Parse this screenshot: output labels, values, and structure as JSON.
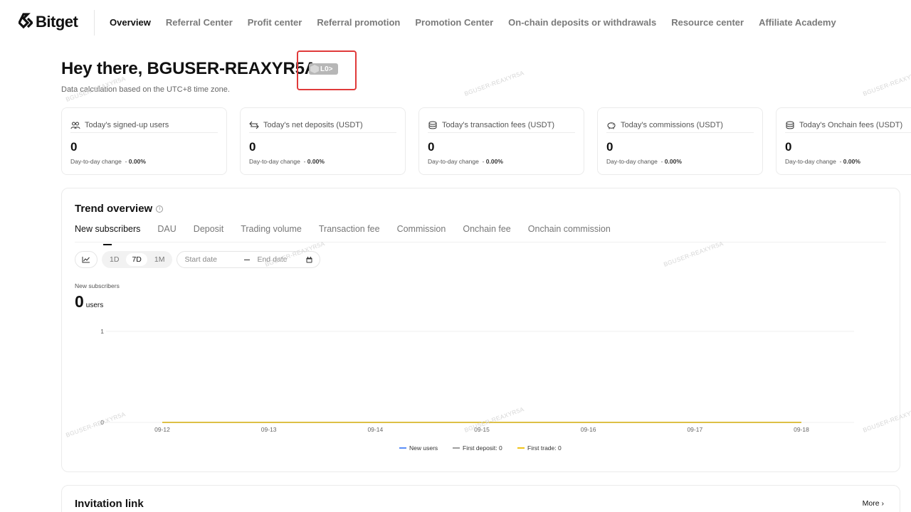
{
  "brand": {
    "name": "Bitget"
  },
  "nav": {
    "items": [
      "Overview",
      "Referral Center",
      "Profit center",
      "Referral promotion",
      "Promotion Center",
      "On-chain deposits or withdrawals",
      "Resource center",
      "Affiliate Academy"
    ],
    "active_index": 0
  },
  "greeting": {
    "text": "Hey there, BGUSER-REAXYR5A",
    "level": "L0>",
    "tz_note": "Data calculation based on the UTC+8 time zone."
  },
  "stats": [
    {
      "label": "Today's signed-up users",
      "icon": "users-icon",
      "value": "0",
      "change_label": "Day-to-day change",
      "change_value": "0.00%"
    },
    {
      "label": "Today's net deposits (USDT)",
      "icon": "transfer-arrows-icon",
      "value": "0",
      "change_label": "Day-to-day change",
      "change_value": "0.00%"
    },
    {
      "label": "Today's transaction fees (USDT)",
      "icon": "coin-stack-icon",
      "value": "0",
      "change_label": "Day-to-day change",
      "change_value": "0.00%"
    },
    {
      "label": "Today's commissions (USDT)",
      "icon": "piggy-bank-icon",
      "value": "0",
      "change_label": "Day-to-day change",
      "change_value": "0.00%"
    },
    {
      "label": "Today's Onchain fees (USDT)",
      "icon": "coin-stack-icon",
      "value": "0",
      "change_label": "Day-to-day change",
      "change_value": "0.00%"
    }
  ],
  "trend": {
    "title": "Trend overview",
    "tabs": [
      "New subscribers",
      "DAU",
      "Deposit",
      "Trading volume",
      "Transaction fee",
      "Commission",
      "Onchain fee",
      "Onchain commission"
    ],
    "active_tab": 0,
    "ranges": [
      "1D",
      "7D",
      "1M"
    ],
    "active_range": 1,
    "date_start_placeholder": "Start date",
    "date_end_placeholder": "End date",
    "metric_label": "New subscribers",
    "metric_value": "0",
    "metric_unit": "users"
  },
  "chart_data": {
    "type": "line",
    "x": [
      "09-12",
      "09-13",
      "09-14",
      "09-15",
      "09-16",
      "09-17",
      "09-18"
    ],
    "series": [
      {
        "name": "New users",
        "values": [
          0,
          0,
          0,
          0,
          0,
          0,
          0
        ],
        "color": "#5b8ff9"
      },
      {
        "name": "First deposit: 0",
        "values": [
          0,
          0,
          0,
          0,
          0,
          0,
          0
        ],
        "color": "#9e9e9e"
      },
      {
        "name": "First trade: 0",
        "values": [
          0,
          0,
          0,
          0,
          0,
          0,
          0
        ],
        "color": "#f0c419"
      }
    ],
    "y_ticks": [
      "0",
      "1"
    ],
    "ylim": [
      0,
      1
    ],
    "grid": true,
    "legend": "bottom-center"
  },
  "invitation": {
    "title": "Invitation link",
    "more": "More ›"
  },
  "watermark_text": "BGUSER-REAXYR5A",
  "colors": {
    "highlight": "#e03a3a",
    "accent_line": "#f0c419"
  }
}
